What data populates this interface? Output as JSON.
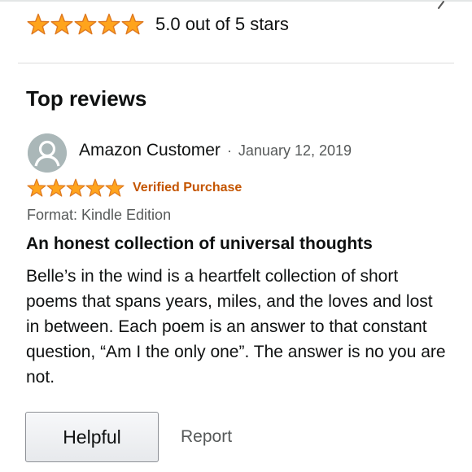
{
  "summary": {
    "rating": 5,
    "max_rating": 5,
    "rating_text": "5.0 out of 5 stars"
  },
  "section": {
    "title": "Top reviews"
  },
  "review": {
    "author": "Amazon Customer",
    "separator": "·",
    "date": "January 12, 2019",
    "rating": 5,
    "verified_label": "Verified Purchase",
    "format": "Format: Kindle Edition",
    "title": "An honest collection of universal thoughts",
    "body": "Belle’s in the wind is a heartfelt collection of short poems that spans years, miles, and the loves and lost in between. Each poem is an answer to that constant question, “Am I the only one”. The answer is no you are not."
  },
  "actions": {
    "helpful_label": "Helpful",
    "report_label": "Report"
  },
  "icons": {
    "star": "star-icon",
    "avatar": "user-avatar-icon",
    "chevron": "chevron-right-icon"
  },
  "colors": {
    "star_fill": "#ffa41c",
    "star_stroke": "#de7921",
    "verified": "#c45500",
    "muted_text": "#565959",
    "avatar_bg": "#aab7b8"
  }
}
